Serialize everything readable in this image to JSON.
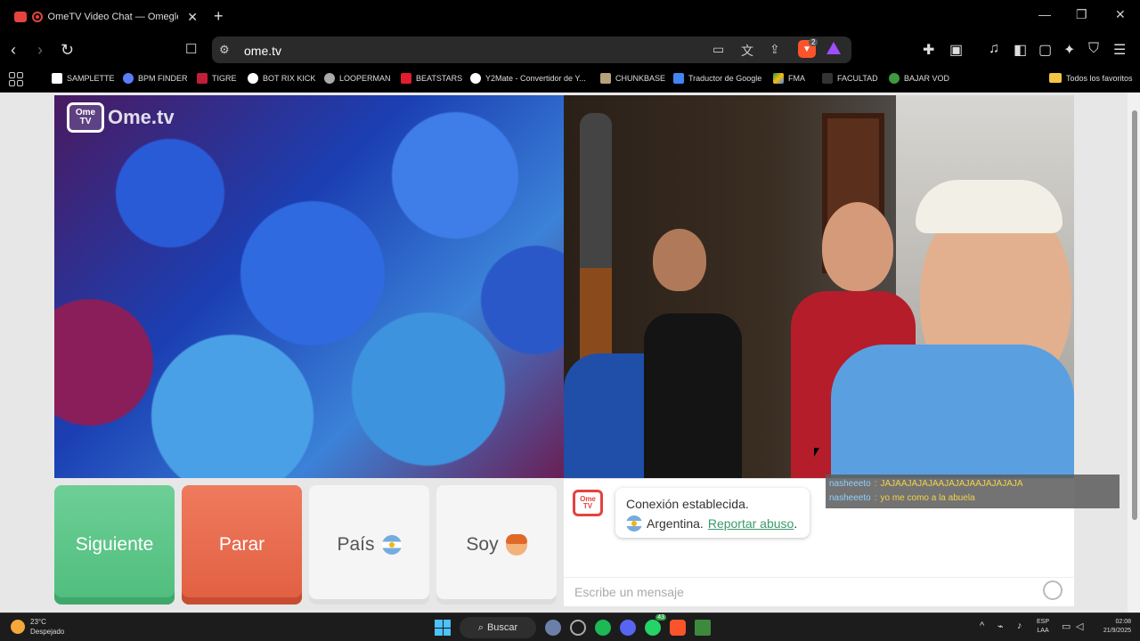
{
  "browser": {
    "tab_title": "OmeTV Video Chat — Omegle Random",
    "url": "ome.tv",
    "shield_count": "2",
    "bookmarks": [
      "SAMPLETTE",
      "BPM FINDER",
      "TIGRE",
      "BOT RIX KICK",
      "LOOPERMAN",
      "BEATSTARS",
      "Y2Mate - Convertidor de Y...",
      "CHUNKBASE",
      "Traductor de Google",
      "FMA",
      "FACULTAD",
      "BAJAR VOD"
    ],
    "all_bookmarks": "Todos los favoritos"
  },
  "video": {
    "logo_tv": "Ome TV",
    "logo_text": "Ome.tv"
  },
  "controls": {
    "next_label": "Siguiente",
    "stop_label": "Parar",
    "country_label": "País",
    "soy_label": "Soy"
  },
  "chat": {
    "logo": "Ome TV",
    "status": "Conexión establecida.",
    "country": "Argentina.",
    "report_link": "Reportar abuso",
    "period": ".",
    "placeholder": "Escribe un mensaje"
  },
  "overlay": {
    "messages": [
      {
        "user": "nasheeeto",
        "sep": ":",
        "text": "JAJAAJAJAJAAJAJAJAAJAJAJAJA"
      },
      {
        "user": "nasheeeto",
        "sep": ":",
        "text": "yo me como a la abuela"
      }
    ]
  },
  "taskbar": {
    "temp": "23°C",
    "weather": "Despejado",
    "search": "Buscar",
    "whatsapp_badge": "43",
    "lang_top": "ESP",
    "lang_bottom": "LAA",
    "time": "02:08",
    "date": "21/9/2025"
  },
  "colors": {
    "next": "#4fbd7d",
    "stop": "#e15f42",
    "link": "#3a9a6a",
    "brand": "#e4433e"
  }
}
